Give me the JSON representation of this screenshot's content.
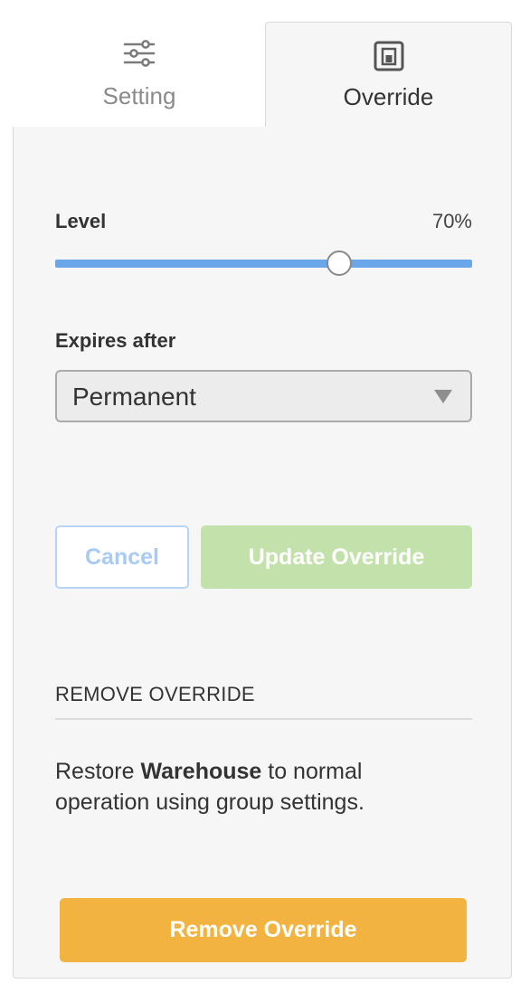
{
  "tabs": {
    "setting": {
      "label": "Setting",
      "icon": "sliders-icon"
    },
    "override": {
      "label": "Override",
      "icon": "override-box-icon",
      "active": true
    }
  },
  "level": {
    "label": "Level",
    "value_text": "70%",
    "value": 0.7
  },
  "expires": {
    "label": "Expires after",
    "selected": "Permanent"
  },
  "buttons": {
    "cancel": "Cancel",
    "update": "Update Override",
    "remove": "Remove Override"
  },
  "remove_section": {
    "heading": "REMOVE OVERRIDE",
    "text_prefix": "Restore ",
    "target_name": "Warehouse",
    "text_suffix": " to normal operation using group settings."
  },
  "colors": {
    "slider": "#6aa7ea",
    "update_button": "#c3e2ab",
    "remove_button": "#f2b340",
    "cancel_border": "#b7d4f4"
  }
}
